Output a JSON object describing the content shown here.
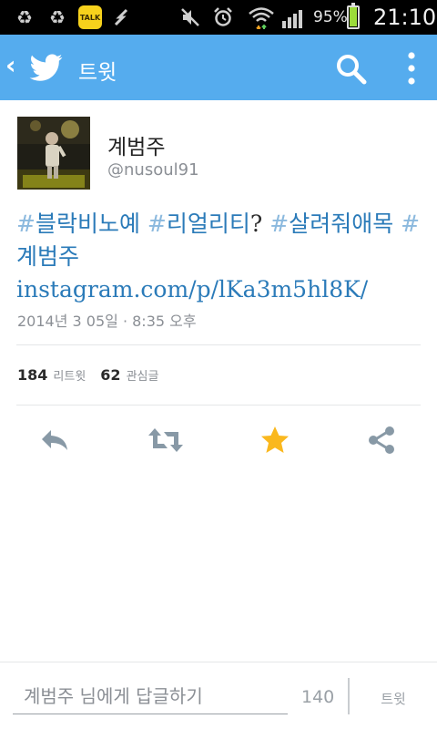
{
  "status_bar": {
    "talk_badge": "TALK",
    "battery_percent": "95%",
    "battery_level": 0.95,
    "time": "21:10"
  },
  "action_bar": {
    "title": "트윗",
    "color": "#55acee",
    "icons": [
      "back-chevron-icon",
      "twitter-bird-icon",
      "search-icon",
      "overflow-menu-icon"
    ]
  },
  "tweet": {
    "display_name": "계범주",
    "handle": "@nusoul91",
    "text": {
      "h1_hash": "#",
      "h1_tag": "블락비노예",
      "space1": " ",
      "h2_hash": "#",
      "h2_tag": "리얼리티",
      "q": "? ",
      "h3_hash": "#",
      "h3_tag": "살려줘애목",
      "space2": " ",
      "h4_hash": "#",
      "h4_tag": "계범주",
      "space3": " ",
      "link": "instagram.com/p/lKa3m5hl8K/"
    },
    "timestamp": "2014년 3 05일 · 8:35 오후",
    "retweet_count": "184",
    "retweet_label": "리트윗",
    "favorite_count": "62",
    "favorite_label": "관심글"
  },
  "actions": [
    "reply-icon",
    "retweet-icon",
    "favorite-star-icon",
    "share-icon"
  ],
  "colors": {
    "link": "#2b7bb9",
    "hash": "#8bb9de",
    "star": "#fab81e",
    "action_gray": "#8899a6"
  },
  "composer": {
    "placeholder": "계범주 님에게 답글하기",
    "char_count": "140",
    "tweet_button": "트윗"
  }
}
